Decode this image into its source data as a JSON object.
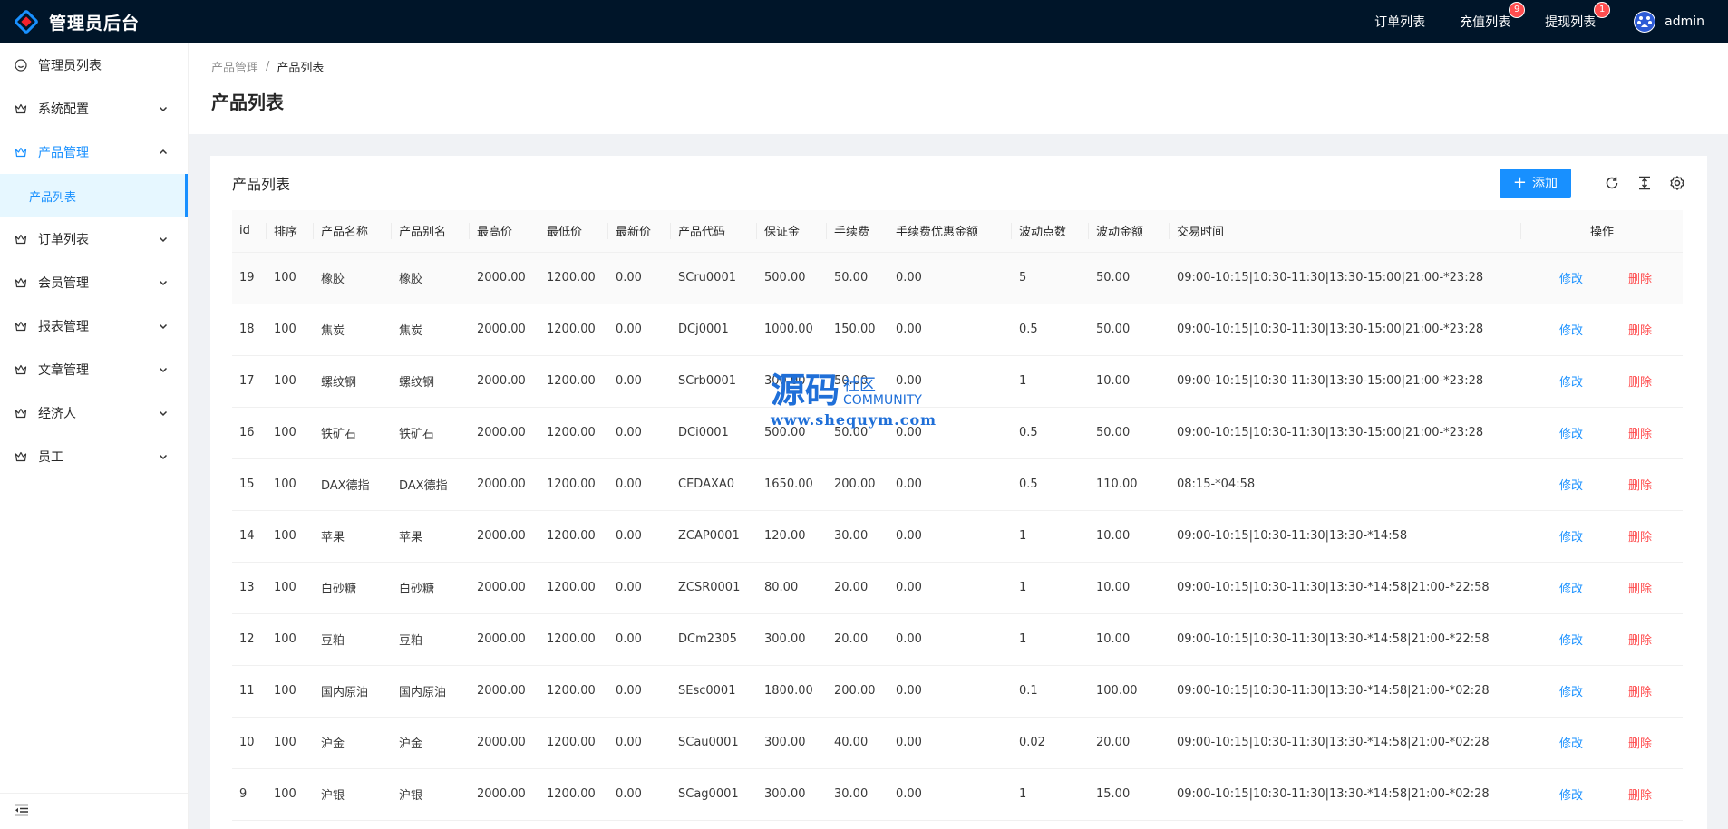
{
  "header": {
    "app_title": "管理员后台",
    "links": [
      {
        "label": "订单列表",
        "badge": ""
      },
      {
        "label": "充值列表",
        "badge": "9"
      },
      {
        "label": "提现列表",
        "badge": "1"
      }
    ],
    "user_name": "admin",
    "colors": {
      "bg": "#001529",
      "badge": "#ff4d4f",
      "logo_blue": "#1890ff",
      "logo_red": "#f5222d"
    }
  },
  "sidebar": {
    "items": [
      {
        "label": "管理员列表",
        "icon": "smile-icon",
        "expandable": false
      },
      {
        "label": "系统配置",
        "icon": "crown-icon",
        "expandable": true
      },
      {
        "label": "产品管理",
        "icon": "crown-icon",
        "expandable": true,
        "open": true
      },
      {
        "label": "订单列表",
        "icon": "crown-icon",
        "expandable": true
      },
      {
        "label": "会员管理",
        "icon": "crown-icon",
        "expandable": true
      },
      {
        "label": "报表管理",
        "icon": "crown-icon",
        "expandable": true
      },
      {
        "label": "文章管理",
        "icon": "crown-icon",
        "expandable": true
      },
      {
        "label": "经济人",
        "icon": "crown-icon",
        "expandable": true
      },
      {
        "label": "员工",
        "icon": "crown-icon",
        "expandable": true
      }
    ],
    "active_sub": "产品列表",
    "accent": "#1890ff"
  },
  "page": {
    "breadcrumb": [
      "产品管理",
      "产品列表"
    ],
    "breadcrumb_sep": "/",
    "title": "产品列表"
  },
  "card": {
    "title": "产品列表",
    "add_label": "添加",
    "toolbar_icons": [
      "reload-icon",
      "column-height-icon",
      "setting-icon"
    ]
  },
  "table": {
    "columns": [
      "id",
      "排序",
      "产品名称",
      "产品别名",
      "最高价",
      "最低价",
      "最新价",
      "产品代码",
      "保证金",
      "手续费",
      "手续费优惠金额",
      "波动点数",
      "波动金额",
      "交易时间",
      "操作"
    ],
    "edit_label": "修改",
    "delete_label": "删除",
    "rows": [
      [
        "19",
        "100",
        "橡胶",
        "橡胶",
        "2000.00",
        "1200.00",
        "0.00",
        "SCru0001",
        "500.00",
        "50.00",
        "0.00",
        "5",
        "50.00",
        "09:00-10:15|10:30-11:30|13:30-15:00|21:00-*23:28"
      ],
      [
        "18",
        "100",
        "焦炭",
        "焦炭",
        "2000.00",
        "1200.00",
        "0.00",
        "DCj0001",
        "1000.00",
        "150.00",
        "0.00",
        "0.5",
        "50.00",
        "09:00-10:15|10:30-11:30|13:30-15:00|21:00-*23:28"
      ],
      [
        "17",
        "100",
        "螺纹钢",
        "螺纹钢",
        "2000.00",
        "1200.00",
        "0.00",
        "SCrb0001",
        "300.00",
        "50.00",
        "0.00",
        "1",
        "10.00",
        "09:00-10:15|10:30-11:30|13:30-15:00|21:00-*23:28"
      ],
      [
        "16",
        "100",
        "铁矿石",
        "铁矿石",
        "2000.00",
        "1200.00",
        "0.00",
        "DCi0001",
        "500.00",
        "50.00",
        "0.00",
        "0.5",
        "50.00",
        "09:00-10:15|10:30-11:30|13:30-15:00|21:00-*23:28"
      ],
      [
        "15",
        "100",
        "DAX德指",
        "DAX德指",
        "2000.00",
        "1200.00",
        "0.00",
        "CEDAXA0",
        "1650.00",
        "200.00",
        "0.00",
        "0.5",
        "110.00",
        "08:15-*04:58"
      ],
      [
        "14",
        "100",
        "苹果",
        "苹果",
        "2000.00",
        "1200.00",
        "0.00",
        "ZCAP0001",
        "120.00",
        "30.00",
        "0.00",
        "1",
        "10.00",
        "09:00-10:15|10:30-11:30|13:30-*14:58"
      ],
      [
        "13",
        "100",
        "白砂糖",
        "白砂糖",
        "2000.00",
        "1200.00",
        "0.00",
        "ZCSR0001",
        "80.00",
        "20.00",
        "0.00",
        "1",
        "10.00",
        "09:00-10:15|10:30-11:30|13:30-*14:58|21:00-*22:58"
      ],
      [
        "12",
        "100",
        "豆粕",
        "豆粕",
        "2000.00",
        "1200.00",
        "0.00",
        "DCm2305",
        "300.00",
        "20.00",
        "0.00",
        "1",
        "10.00",
        "09:00-10:15|10:30-11:30|13:30-*14:58|21:00-*22:58"
      ],
      [
        "11",
        "100",
        "国内原油",
        "国内原油",
        "2000.00",
        "1200.00",
        "0.00",
        "SEsc0001",
        "1800.00",
        "200.00",
        "0.00",
        "0.1",
        "100.00",
        "09:00-10:15|10:30-11:30|13:30-*14:58|21:00-*02:28"
      ],
      [
        "10",
        "100",
        "沪金",
        "沪金",
        "2000.00",
        "1200.00",
        "0.00",
        "SCau0001",
        "300.00",
        "40.00",
        "0.00",
        "0.02",
        "20.00",
        "09:00-10:15|10:30-11:30|13:30-*14:58|21:00-*02:28"
      ],
      [
        "9",
        "100",
        "沪银",
        "沪银",
        "2000.00",
        "1200.00",
        "0.00",
        "SCag0001",
        "300.00",
        "30.00",
        "0.00",
        "1",
        "15.00",
        "09:00-10:15|10:30-11:30|13:30-*14:58|21:00-*02:28"
      ]
    ]
  },
  "watermark": {
    "big": "源码",
    "cn": "社区",
    "en": "COMMUNITY",
    "url": "www.shequym.com"
  }
}
